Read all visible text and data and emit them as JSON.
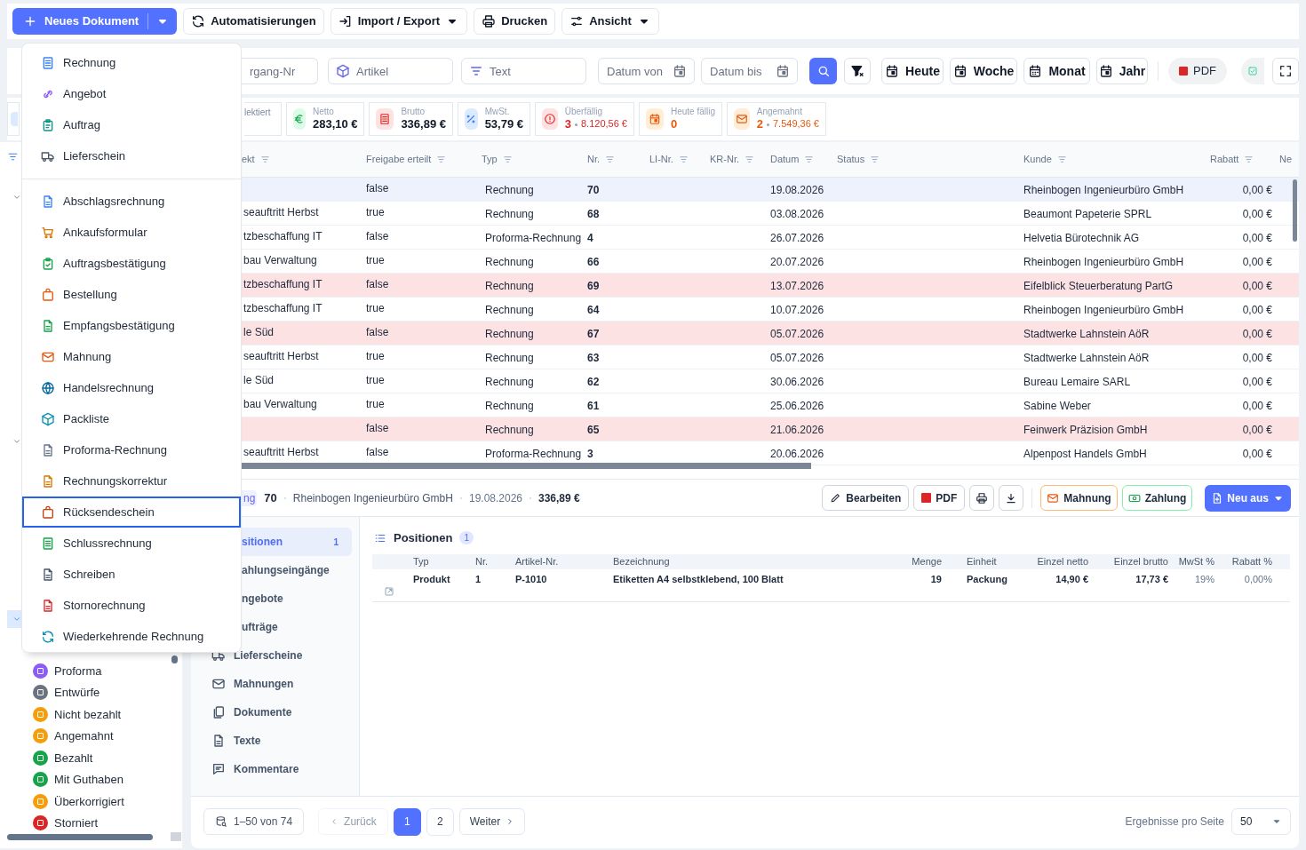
{
  "toolbar": {
    "new_document": {
      "label": "Neues Dokument"
    },
    "buttons": [
      {
        "label": "Automatisierungen",
        "dropdown": false
      },
      {
        "label": "Import / Export",
        "dropdown": true
      },
      {
        "label": "Drucken",
        "dropdown": false
      },
      {
        "label": "Ansicht",
        "dropdown": true
      }
    ]
  },
  "new_document_menu": {
    "sections": [
      {
        "items": [
          {
            "label": "Rechnung",
            "selected": false
          },
          {
            "label": "Angebot",
            "selected": false
          },
          {
            "label": "Auftrag",
            "selected": false
          },
          {
            "label": "Lieferschein",
            "selected": false
          }
        ]
      },
      {
        "items": [
          {
            "label": "Abschlagsrechnung",
            "selected": false
          },
          {
            "label": "Ankaufsformular",
            "selected": false
          },
          {
            "label": "Auftragsbestätigung",
            "selected": false
          },
          {
            "label": "Bestellung",
            "selected": false
          },
          {
            "label": "Empfangsbestätigung",
            "selected": false
          },
          {
            "label": "Mahnung",
            "selected": false
          },
          {
            "label": "Handelsrechnung",
            "selected": false
          },
          {
            "label": "Packliste",
            "selected": false
          },
          {
            "label": "Proforma-Rechnung",
            "selected": false
          },
          {
            "label": "Rechnungskorrektur",
            "selected": false
          },
          {
            "label": "Rücksendeschein",
            "selected": true
          },
          {
            "label": "Schlussrechnung",
            "selected": false
          },
          {
            "label": "Schreiben",
            "selected": false
          },
          {
            "label": "Stornorechnung",
            "selected": false
          },
          {
            "label": "Wiederkehrende Rechnung",
            "selected": false
          }
        ]
      }
    ]
  },
  "filters": {
    "fields": [
      {
        "placeholder": "rgang-Nr",
        "kind": "text"
      },
      {
        "placeholder": "Artikel",
        "kind": "article"
      },
      {
        "placeholder": "Text",
        "kind": "search"
      },
      {
        "placeholder": "Datum von",
        "kind": "date"
      },
      {
        "placeholder": "Datum bis",
        "kind": "date"
      }
    ],
    "ranges": [
      {
        "label": "Heute"
      },
      {
        "label": "Woche"
      },
      {
        "label": "Monat"
      },
      {
        "label": "Jahr"
      }
    ],
    "pdf": {
      "label": "PDF"
    }
  },
  "stats": [
    {
      "label": "lektiert",
      "kind": "cut"
    },
    {
      "label": "Netto",
      "value": "283,10 €",
      "kind": "netto"
    },
    {
      "label": "Brutto",
      "value": "336,89 €",
      "kind": "brutto"
    },
    {
      "label": "MwSt.",
      "value": "53,79 €",
      "kind": "tax"
    },
    {
      "label": "Überfällig",
      "value": "3",
      "amount": "8.120,56 €",
      "kind": "overdue"
    },
    {
      "label": "Heute fällig",
      "value": "0",
      "kind": "due"
    },
    {
      "label": "Angemahnt",
      "value": "2",
      "amount": "7.549,36 €",
      "kind": "dunned"
    }
  ],
  "sidebar": {
    "tree_toggles": [
      {
        "expanded": true,
        "selected": false
      },
      {
        "expanded": true,
        "selected": false
      },
      {
        "expanded": true,
        "selected": true
      }
    ],
    "items": [
      {
        "label": "Proforma",
        "color": "#8b5cf6"
      },
      {
        "label": "Entwürfe",
        "color": "#6b7280"
      },
      {
        "label": "Nicht bezahlt",
        "color": "#f59e0b"
      },
      {
        "label": "Angemahnt",
        "color": "#f59e0b"
      },
      {
        "label": "Bezahlt",
        "color": "#16a34a"
      },
      {
        "label": "Mit Guthaben",
        "color": "#16a34a"
      },
      {
        "label": "Überkorrigiert",
        "color": "#f59e0b"
      },
      {
        "label": "Storniert",
        "color": "#dc2626"
      }
    ]
  },
  "table": {
    "columns": [
      {
        "label": "ekt",
        "filter_icon": true
      },
      {
        "label": "Freigabe erteilt",
        "filter_icon": true
      },
      {
        "label": "Typ",
        "filter_icon": true
      },
      {
        "label": "Nr.",
        "filter_icon": true
      },
      {
        "label": "LI-Nr.",
        "filter_icon": true
      },
      {
        "label": "KR-Nr.",
        "filter_icon": true
      },
      {
        "label": "Datum",
        "filter_icon": true
      },
      {
        "label": "Status",
        "filter_icon": true
      },
      {
        "label": "Kunde",
        "filter_icon": true
      },
      {
        "label": "Rabatt",
        "filter_icon": true
      },
      {
        "label": "Ne",
        "filter_icon": false
      }
    ],
    "rows": [
      {
        "freigabe": "false",
        "typ": "Rechnung",
        "nr": "70",
        "datum": "19.08.2026",
        "kunde": "Rheinbogen Ingenieurbüro GmbH",
        "rabatt": "0,00 €",
        "selected": true,
        "overdue": false
      },
      {
        "column_1": "seauftritt Herbst",
        "freigabe": "true",
        "typ": "Rechnung",
        "nr": "68",
        "datum": "03.08.2026",
        "kunde": "Beaumont Papeterie SPRL",
        "rabatt": "0,00 €",
        "selected": false,
        "overdue": false
      },
      {
        "column_1": "tzbeschaffung IT",
        "freigabe": "false",
        "typ": "Proforma-Rechnung",
        "nr": "4",
        "datum": "26.07.2026",
        "kunde": "Helvetia Bürotechnik AG",
        "rabatt": "0,00 €",
        "selected": false,
        "overdue": false
      },
      {
        "column_1": "bau Verwaltung",
        "freigabe": "true",
        "typ": "Rechnung",
        "nr": "66",
        "datum": "20.07.2026",
        "kunde": "Rheinbogen Ingenieurbüro GmbH",
        "rabatt": "0,00 €",
        "selected": false,
        "overdue": false
      },
      {
        "column_1": "tzbeschaffung IT",
        "freigabe": "false",
        "typ": "Rechnung",
        "nr": "69",
        "datum": "13.07.2026",
        "kunde": "Eifelblick Steuerberatung PartG",
        "rabatt": "0,00 €",
        "selected": false,
        "overdue": true
      },
      {
        "column_1": "tzbeschaffung IT",
        "freigabe": "true",
        "typ": "Rechnung",
        "nr": "64",
        "datum": "10.07.2026",
        "kunde": "Rheinbogen Ingenieurbüro GmbH",
        "rabatt": "0,00 €",
        "selected": false,
        "overdue": false
      },
      {
        "column_1": "le Süd",
        "freigabe": "false",
        "typ": "Rechnung",
        "nr": "67",
        "datum": "05.07.2026",
        "kunde": "Stadtwerke Lahnstein AöR",
        "rabatt": "0,00 €",
        "selected": false,
        "overdue": true
      },
      {
        "column_1": "seauftritt Herbst",
        "freigabe": "true",
        "typ": "Rechnung",
        "nr": "63",
        "datum": "05.07.2026",
        "kunde": "Stadtwerke Lahnstein AöR",
        "rabatt": "0,00 €",
        "selected": false,
        "overdue": false
      },
      {
        "column_1": "le Süd",
        "freigabe": "true",
        "typ": "Rechnung",
        "nr": "62",
        "datum": "30.06.2026",
        "kunde": "Bureau Lemaire SARL",
        "rabatt": "0,00 €",
        "selected": false,
        "overdue": false
      },
      {
        "column_1": "bau Verwaltung",
        "freigabe": "true",
        "typ": "Rechnung",
        "nr": "61",
        "datum": "25.06.2026",
        "kunde": "Sabine  Weber",
        "rabatt": "0,00 €",
        "selected": false,
        "overdue": false
      },
      {
        "freigabe": "false",
        "typ": "Rechnung",
        "nr": "65",
        "datum": "21.06.2026",
        "kunde": "Feinwerk Präzision GmbH",
        "rabatt": "0,00 €",
        "selected": false,
        "overdue": true
      },
      {
        "column_1": "seauftritt Herbst",
        "freigabe": "false",
        "typ": "Proforma-Rechnung",
        "nr": "3",
        "datum": "20.06.2026",
        "kunde": "Alpenpost Handels GmbH",
        "rabatt": "0,00 €",
        "selected": false,
        "overdue": false
      }
    ]
  },
  "detail": {
    "type_badge": "ng",
    "number": "70",
    "customer": "Rheinbogen Ingenieurbüro GmbH",
    "date": "19.08.2026",
    "amount": "336,89 €",
    "actions": [
      {
        "kind": "edit",
        "label": "Bearbeiten"
      },
      {
        "kind": "pdf",
        "label": "PDF"
      },
      {
        "kind": "print"
      },
      {
        "kind": "download"
      },
      {
        "kind": "dunning",
        "label": "Mahnung"
      },
      {
        "kind": "payment",
        "label": "Zahlung"
      },
      {
        "kind": "primary",
        "label": "Neu aus"
      }
    ],
    "tabs": [
      {
        "label": "sitionen",
        "count": "1",
        "selected": true,
        "covered": true
      },
      {
        "label": "ahlungseingänge",
        "selected": false,
        "covered": true
      },
      {
        "label": "ngebote",
        "selected": false,
        "covered": true
      },
      {
        "label": "ufträge",
        "selected": false,
        "covered": true
      },
      {
        "label": "Lieferscheine",
        "selected": false,
        "covered": false
      },
      {
        "label": "Mahnungen",
        "selected": false,
        "covered": false
      },
      {
        "label": "Dokumente",
        "selected": false,
        "covered": false
      },
      {
        "label": "Texte",
        "selected": false,
        "covered": false
      },
      {
        "label": "Kommentare",
        "selected": false,
        "covered": false
      }
    ],
    "positions": {
      "title": "Positionen",
      "count": "1",
      "columns": [
        "Typ",
        "Nr.",
        "Artikel-Nr.",
        "Bezeichnung",
        "Menge",
        "Einheit",
        "Einzel netto",
        "Einzel brutto",
        "MwSt %",
        "Rabatt %"
      ],
      "rows": [
        {
          "cells": [
            "Produkt",
            "1",
            "P-1010",
            "Etiketten A4 selbstklebend, 100 Blatt",
            "19",
            "Packung",
            "14,90 €",
            "17,73 €",
            "19%",
            "0,00%"
          ]
        }
      ]
    }
  },
  "pagination": {
    "range": "1–50 von 74",
    "previous": {
      "label": "Zurück",
      "disabled": true
    },
    "pages": [
      {
        "label": "1",
        "selected": true
      },
      {
        "label": "2",
        "selected": false
      }
    ],
    "next": {
      "label": "Weiter",
      "disabled": false
    },
    "per_page_label": "Ergebnisse pro Seite",
    "per_page": "50"
  }
}
